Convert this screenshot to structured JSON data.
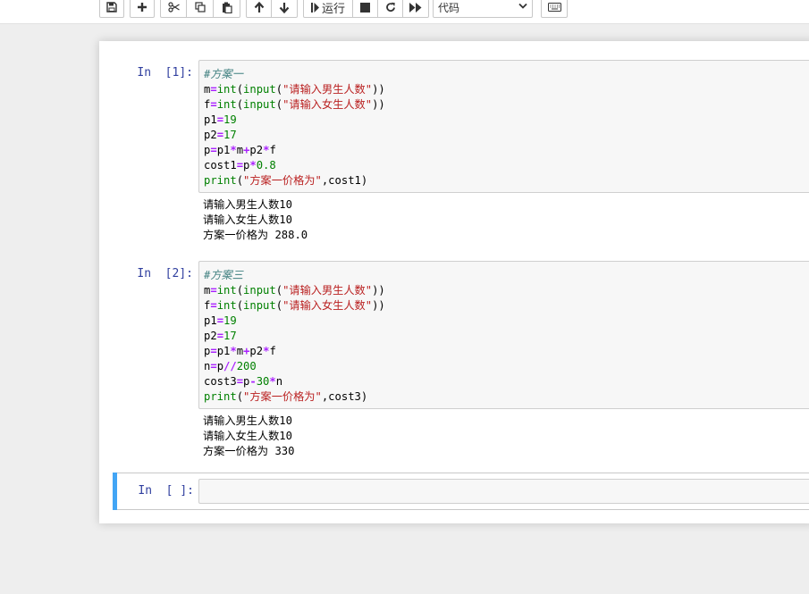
{
  "toolbar": {
    "buttons": [
      {
        "name": "save",
        "icon": "save-icon"
      },
      {
        "name": "add-cell",
        "icon": "plus-icon"
      },
      {
        "name": "cut",
        "icon": "scissors-icon"
      },
      {
        "name": "copy",
        "icon": "copy-icon"
      },
      {
        "name": "paste",
        "icon": "paste-icon"
      },
      {
        "name": "move-up",
        "icon": "arrow-up-icon"
      },
      {
        "name": "move-down",
        "icon": "arrow-down-icon"
      },
      {
        "name": "run",
        "icon": "step-forward-icon"
      },
      {
        "name": "interrupt",
        "icon": "stop-icon"
      },
      {
        "name": "restart",
        "icon": "redo-icon"
      },
      {
        "name": "restart-run-all",
        "icon": "fast-forward-icon"
      },
      {
        "name": "command-palette",
        "icon": "keyboard-icon"
      }
    ],
    "run_label": "运行",
    "cell_type": "代码"
  },
  "cells": [
    {
      "prompt": "In  [1]:",
      "code": [
        [
          {
            "t": "comment",
            "v": "#方案一"
          }
        ],
        [
          {
            "t": "text",
            "v": "m"
          },
          {
            "t": "op",
            "v": "="
          },
          {
            "t": "builtin",
            "v": "int"
          },
          {
            "t": "text",
            "v": "("
          },
          {
            "t": "builtin",
            "v": "input"
          },
          {
            "t": "text",
            "v": "("
          },
          {
            "t": "str",
            "v": "\"请输入男生人数\""
          },
          {
            "t": "text",
            "v": "))"
          }
        ],
        [
          {
            "t": "text",
            "v": "f"
          },
          {
            "t": "op",
            "v": "="
          },
          {
            "t": "builtin",
            "v": "int"
          },
          {
            "t": "text",
            "v": "("
          },
          {
            "t": "builtin",
            "v": "input"
          },
          {
            "t": "text",
            "v": "("
          },
          {
            "t": "str",
            "v": "\"请输入女生人数\""
          },
          {
            "t": "text",
            "v": "))"
          }
        ],
        [
          {
            "t": "text",
            "v": "p1"
          },
          {
            "t": "op",
            "v": "="
          },
          {
            "t": "num",
            "v": "19"
          }
        ],
        [
          {
            "t": "text",
            "v": "p2"
          },
          {
            "t": "op",
            "v": "="
          },
          {
            "t": "num",
            "v": "17"
          }
        ],
        [
          {
            "t": "text",
            "v": "p"
          },
          {
            "t": "op",
            "v": "="
          },
          {
            "t": "text",
            "v": "p1"
          },
          {
            "t": "op",
            "v": "*"
          },
          {
            "t": "text",
            "v": "m"
          },
          {
            "t": "op",
            "v": "+"
          },
          {
            "t": "text",
            "v": "p2"
          },
          {
            "t": "op",
            "v": "*"
          },
          {
            "t": "text",
            "v": "f"
          }
        ],
        [
          {
            "t": "text",
            "v": "cost1"
          },
          {
            "t": "op",
            "v": "="
          },
          {
            "t": "text",
            "v": "p"
          },
          {
            "t": "op",
            "v": "*"
          },
          {
            "t": "num",
            "v": "0.8"
          }
        ],
        [
          {
            "t": "builtin",
            "v": "print"
          },
          {
            "t": "text",
            "v": "("
          },
          {
            "t": "str",
            "v": "\"方案一价格为\""
          },
          {
            "t": "text",
            "v": ",cost1)"
          }
        ]
      ],
      "output": [
        "请输入男生人数10",
        "请输入女生人数10",
        "方案一价格为 288.0"
      ]
    },
    {
      "prompt": "In  [2]:",
      "code": [
        [
          {
            "t": "comment",
            "v": "#方案三"
          }
        ],
        [
          {
            "t": "text",
            "v": "m"
          },
          {
            "t": "op",
            "v": "="
          },
          {
            "t": "builtin",
            "v": "int"
          },
          {
            "t": "text",
            "v": "("
          },
          {
            "t": "builtin",
            "v": "input"
          },
          {
            "t": "text",
            "v": "("
          },
          {
            "t": "str",
            "v": "\"请输入男生人数\""
          },
          {
            "t": "text",
            "v": "))"
          }
        ],
        [
          {
            "t": "text",
            "v": "f"
          },
          {
            "t": "op",
            "v": "="
          },
          {
            "t": "builtin",
            "v": "int"
          },
          {
            "t": "text",
            "v": "("
          },
          {
            "t": "builtin",
            "v": "input"
          },
          {
            "t": "text",
            "v": "("
          },
          {
            "t": "str",
            "v": "\"请输入女生人数\""
          },
          {
            "t": "text",
            "v": "))"
          }
        ],
        [
          {
            "t": "text",
            "v": "p1"
          },
          {
            "t": "op",
            "v": "="
          },
          {
            "t": "num",
            "v": "19"
          }
        ],
        [
          {
            "t": "text",
            "v": "p2"
          },
          {
            "t": "op",
            "v": "="
          },
          {
            "t": "num",
            "v": "17"
          }
        ],
        [
          {
            "t": "text",
            "v": "p"
          },
          {
            "t": "op",
            "v": "="
          },
          {
            "t": "text",
            "v": "p1"
          },
          {
            "t": "op",
            "v": "*"
          },
          {
            "t": "text",
            "v": "m"
          },
          {
            "t": "op",
            "v": "+"
          },
          {
            "t": "text",
            "v": "p2"
          },
          {
            "t": "op",
            "v": "*"
          },
          {
            "t": "text",
            "v": "f"
          }
        ],
        [
          {
            "t": "text",
            "v": "n"
          },
          {
            "t": "op",
            "v": "="
          },
          {
            "t": "text",
            "v": "p"
          },
          {
            "t": "op",
            "v": "//"
          },
          {
            "t": "num",
            "v": "200"
          }
        ],
        [
          {
            "t": "text",
            "v": "cost3"
          },
          {
            "t": "op",
            "v": "="
          },
          {
            "t": "text",
            "v": "p"
          },
          {
            "t": "op",
            "v": "-"
          },
          {
            "t": "num",
            "v": "30"
          },
          {
            "t": "op",
            "v": "*"
          },
          {
            "t": "text",
            "v": "n"
          }
        ],
        [
          {
            "t": "builtin",
            "v": "print"
          },
          {
            "t": "text",
            "v": "("
          },
          {
            "t": "str",
            "v": "\"方案一价格为\""
          },
          {
            "t": "text",
            "v": ",cost3)"
          }
        ]
      ],
      "output": [
        "请输入男生人数10",
        "请输入女生人数10",
        "方案一价格为 330"
      ]
    },
    {
      "prompt": "In  [ ]:",
      "code": [],
      "output": []
    }
  ],
  "colors": {
    "prompt": "#303f9f",
    "selected_cell_bar": "#42a5f5",
    "comment": "#408080",
    "operator": "#aa22ff",
    "builtin": "#008000",
    "string": "#ba2121"
  }
}
